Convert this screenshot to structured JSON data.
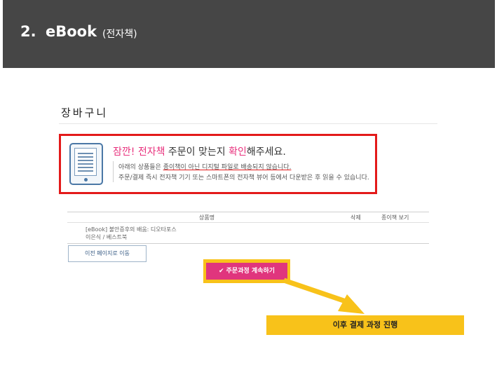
{
  "header": {
    "number": "2.",
    "title": "eBook",
    "subtitle": "(전자책)"
  },
  "cart": {
    "title": "장바구니"
  },
  "notice": {
    "title_part1": "잠깐! 전자책",
    "title_part2": " 주문이 맞는지 ",
    "title_part3": "확인",
    "title_part4": "해주세요.",
    "line1_prefix": "아래의 상품들은 ",
    "line1_underlined": "종이책이 아닌 디지털 파일로 배송되지 않습니다.",
    "line2": "주문/결제 즉시 전자책 기기 또는 스마트폰의 전자책 뷰어 등에서 다운받은 후 읽을 수 있습니다."
  },
  "table": {
    "headers": [
      "상품명",
      "삭제",
      "종이책 보기"
    ],
    "rows": [
      {
        "line1": "[eBook] 불안증후의 배움: 디오타포스",
        "line2": "이은식 / 베스트북"
      }
    ]
  },
  "prev_button": "이전 페이지로 이동",
  "order_button": "주문과정 계속하기",
  "callout": "이후 결제 과정 진행",
  "colors": {
    "header_bg": "#464646",
    "accent_pink": "#e8317d",
    "highlight_yellow": "#f8c21a",
    "notice_border": "#e31a1a"
  }
}
